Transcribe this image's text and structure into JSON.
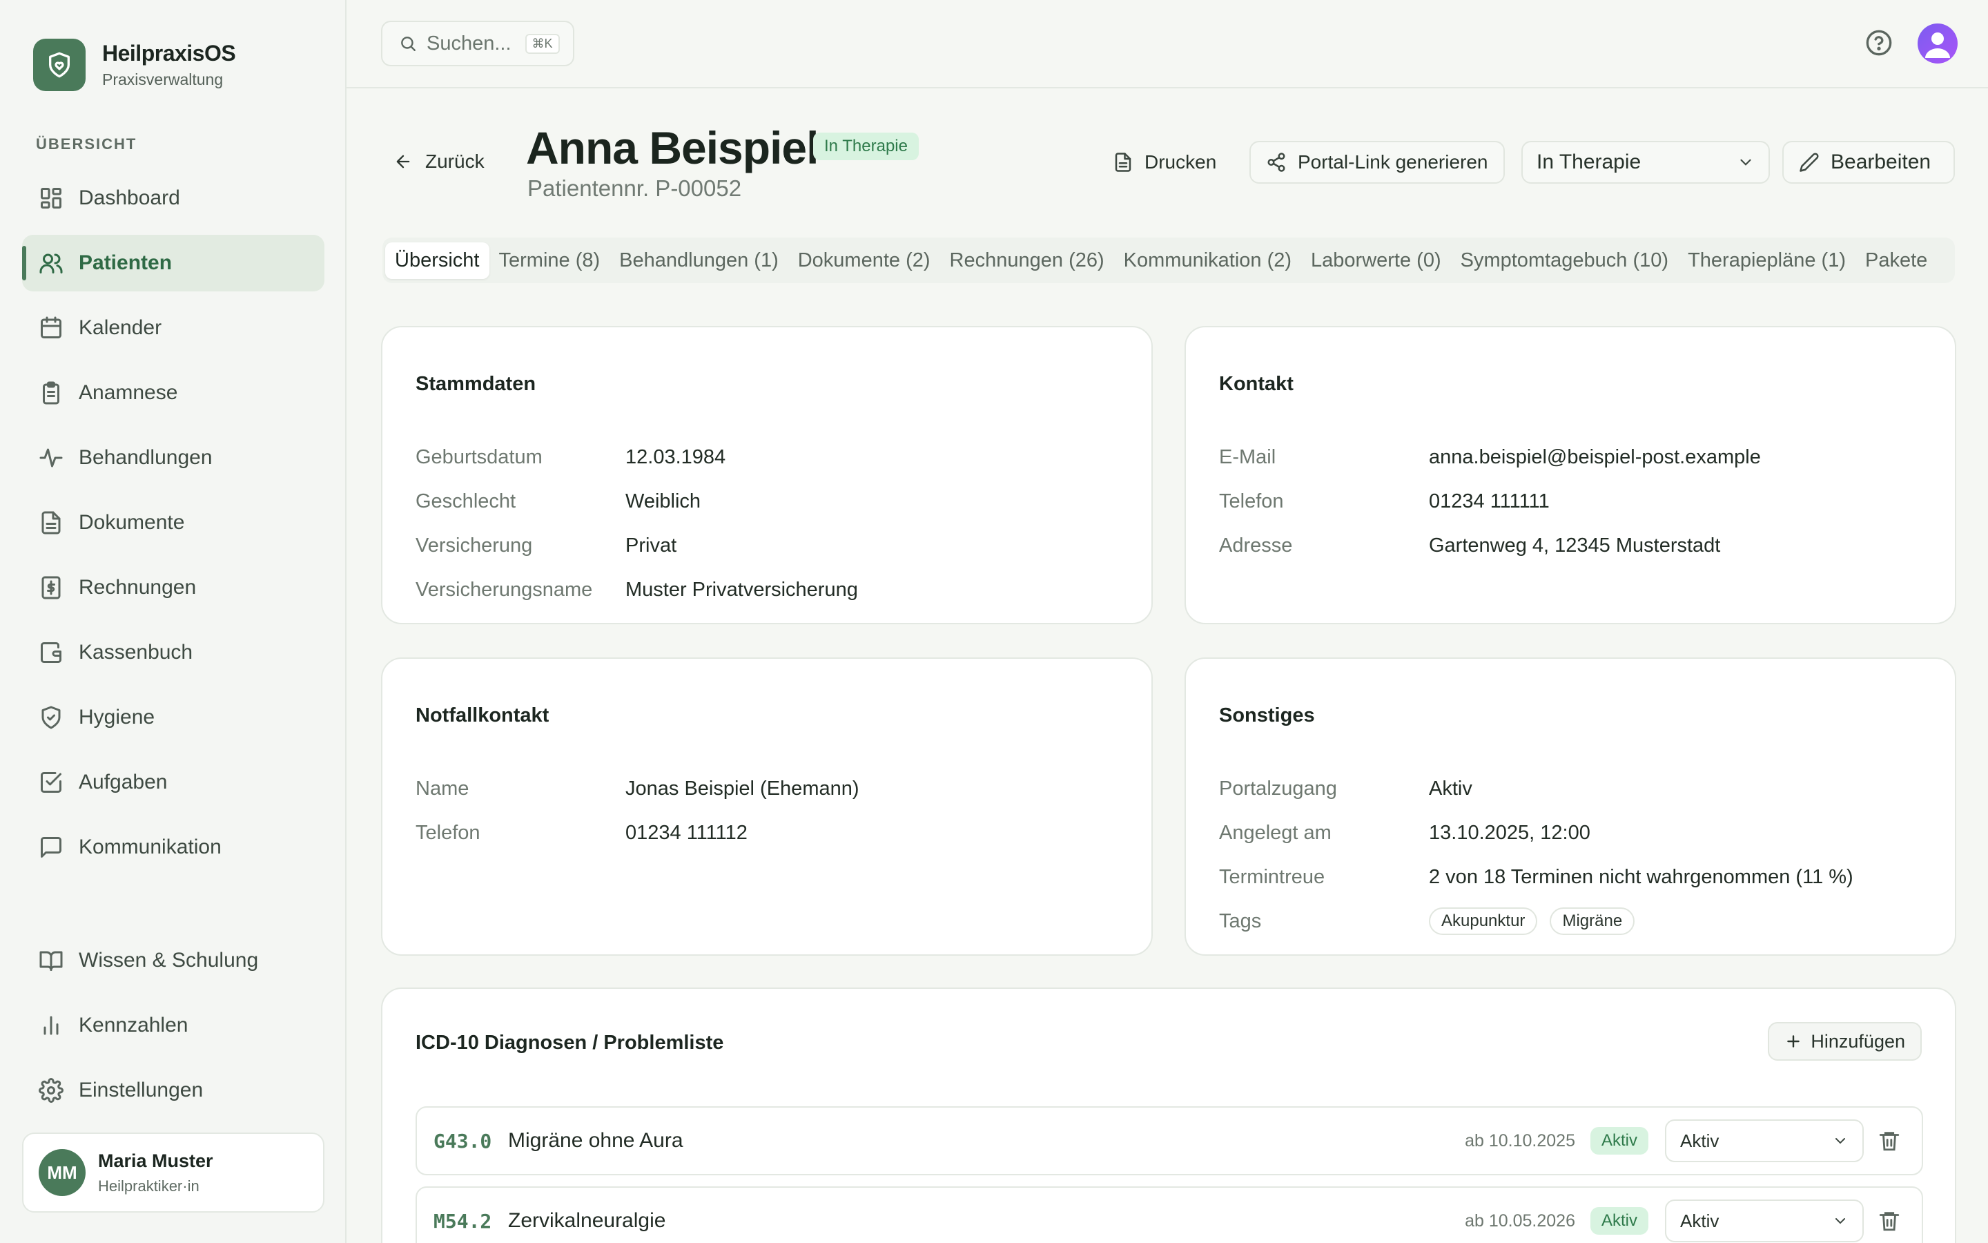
{
  "brand": {
    "name": "HeilpraxisOS",
    "subtitle": "Praxisverwaltung"
  },
  "sidebar": {
    "section_label": "ÜBERSICHT",
    "items": [
      {
        "label": "Dashboard",
        "icon": "dashboard-icon"
      },
      {
        "label": "Patienten",
        "icon": "users-icon",
        "active": true
      },
      {
        "label": "Kalender",
        "icon": "calendar-icon"
      },
      {
        "label": "Anamnese",
        "icon": "clipboard-icon"
      },
      {
        "label": "Behandlungen",
        "icon": "activity-icon"
      },
      {
        "label": "Dokumente",
        "icon": "document-icon"
      },
      {
        "label": "Rechnungen",
        "icon": "invoice-icon"
      },
      {
        "label": "Kassenbuch",
        "icon": "wallet-icon"
      },
      {
        "label": "Hygiene",
        "icon": "shield-icon"
      },
      {
        "label": "Aufgaben",
        "icon": "checkbox-icon"
      },
      {
        "label": "Kommunikation",
        "icon": "message-icon"
      }
    ],
    "bottom_items": [
      {
        "label": "Wissen & Schulung",
        "icon": "book-icon"
      },
      {
        "label": "Kennzahlen",
        "icon": "bar-chart-icon"
      },
      {
        "label": "Einstellungen",
        "icon": "gear-icon"
      }
    ],
    "user": {
      "initials": "MM",
      "name": "Maria Muster",
      "role": "Heilpraktiker·in"
    }
  },
  "topbar": {
    "search_placeholder": "Suchen...",
    "shortcut": "⌘K"
  },
  "header": {
    "back_label": "Zurück",
    "patient_name": "Anna Beispiel",
    "status": "In Therapie",
    "patient_id": "Patientennr. P-00052",
    "print_label": "Drucken",
    "portal_label": "Portal-Link generieren",
    "status_select": "In Therapie",
    "edit_label": "Bearbeiten"
  },
  "tabs": [
    "Übersicht",
    "Termine (8)",
    "Behandlungen (1)",
    "Dokumente (2)",
    "Rechnungen (26)",
    "Kommunikation (2)",
    "Laborwerte (0)",
    "Symptomtagebuch (10)",
    "Therapiepläne (1)",
    "Pakete"
  ],
  "stammdaten": {
    "title": "Stammdaten",
    "rows": [
      {
        "k": "Geburtsdatum",
        "v": "12.03.1984"
      },
      {
        "k": "Geschlecht",
        "v": "Weiblich"
      },
      {
        "k": "Versicherung",
        "v": "Privat"
      },
      {
        "k": "Versicherungsname",
        "v": "Muster Privatversicherung"
      }
    ]
  },
  "kontakt": {
    "title": "Kontakt",
    "rows": [
      {
        "k": "E-Mail",
        "v": "anna.beispiel@beispiel-post.example"
      },
      {
        "k": "Telefon",
        "v": "01234 111111"
      },
      {
        "k": "Adresse",
        "v": "Gartenweg 4, 12345 Musterstadt"
      }
    ]
  },
  "notfall": {
    "title": "Notfallkontakt",
    "rows": [
      {
        "k": "Name",
        "v": "Jonas Beispiel (Ehemann)"
      },
      {
        "k": "Telefon",
        "v": "01234 111112"
      }
    ]
  },
  "sonstiges": {
    "title": "Sonstiges",
    "rows": [
      {
        "k": "Portalzugang",
        "v": "Aktiv"
      },
      {
        "k": "Angelegt am",
        "v": "13.10.2025, 12:00"
      },
      {
        "k": "Termintreue",
        "v": "2 von 18 Terminen nicht wahrgenommen (11 %)"
      }
    ],
    "tags_label": "Tags",
    "tags": [
      "Akupunktur",
      "Migräne"
    ]
  },
  "diagnoses": {
    "title": "ICD-10 Diagnosen / Problemliste",
    "add_label": "Hinzufügen",
    "rows": [
      {
        "code": "G43.0",
        "label": "Migräne ohne Aura",
        "date": "ab 10.10.2025",
        "badge": "Aktiv",
        "select": "Aktiv"
      },
      {
        "code": "M54.2",
        "label": "Zervikalneuralgie",
        "date": "ab 10.05.2026",
        "badge": "Aktiv",
        "select": "Aktiv"
      }
    ]
  },
  "colors": {
    "accent": "#4a7a5a",
    "badge_bg": "#d8f3e0",
    "badge_text": "#2e7a4a",
    "background": "#f5f7f3"
  }
}
